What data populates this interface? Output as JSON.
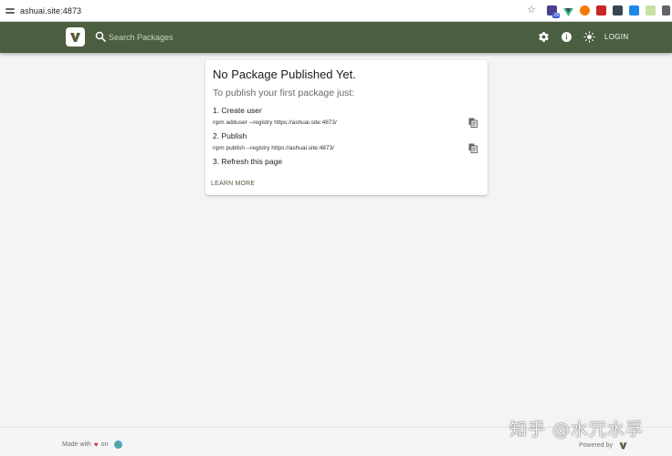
{
  "browser": {
    "url": "ashuai.site:4873",
    "extension_badge": "29",
    "icons": [
      "site-info-icon",
      "bookmark-star-icon",
      "extension-icons"
    ]
  },
  "header": {
    "search_placeholder": "Search Packages",
    "login_label": "LOGIN",
    "icons": [
      "verdaccio-logo-icon",
      "search-icon",
      "settings-icon",
      "info-icon",
      "theme-toggle-icon"
    ],
    "colors": {
      "bar": "#4b5e40"
    }
  },
  "card": {
    "title": "No Package Published Yet.",
    "subtitle": "To publish your first package just:",
    "steps": [
      {
        "label": "1. Create user",
        "command": "npm adduser --registry https://ashuai.site:4873/"
      },
      {
        "label": "2. Publish",
        "command": "npm publish --registry https://ashuai.site:4873/"
      },
      {
        "label": "3. Refresh this page",
        "command": ""
      }
    ],
    "learn_more": "LEARN MORE"
  },
  "footer": {
    "made_with": "Made with",
    "heart": "♥",
    "on": "on",
    "powered_by": "Powered by"
  },
  "watermark": "知乎 @水冗水孚"
}
